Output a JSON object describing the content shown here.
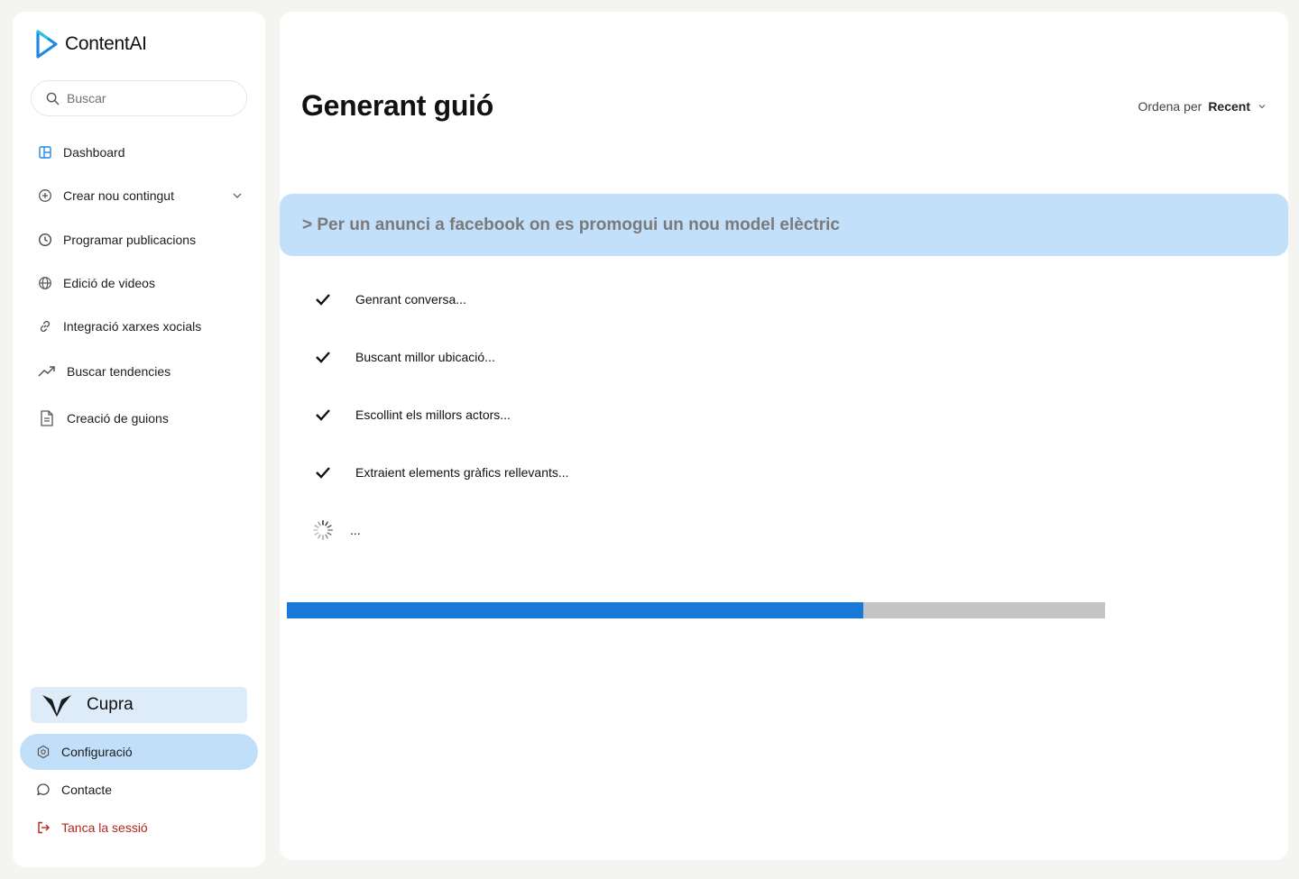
{
  "app": {
    "name": "ContentAI"
  },
  "search": {
    "placeholder": "Buscar"
  },
  "sidebar": {
    "items": [
      {
        "label": "Dashboard",
        "icon": "dashboard-icon"
      },
      {
        "label": "Crear nou contingut",
        "icon": "plus-circle-icon",
        "has_submenu": true
      },
      {
        "label": "Programar publicacions",
        "icon": "clock-icon"
      },
      {
        "label": "Edició de videos",
        "icon": "globe-icon"
      },
      {
        "label": "Integració xarxes xocials",
        "icon": "link-icon"
      },
      {
        "label": "Buscar tendencies",
        "icon": "trending-up-icon"
      },
      {
        "label": "Creació de guions",
        "icon": "document-icon"
      }
    ],
    "brand": {
      "name": "Cupra",
      "icon": "cupra-logo"
    },
    "bottom": {
      "settings": "Configuració",
      "contact": "Contacte",
      "logout": "Tanca la sessió"
    }
  },
  "main": {
    "title": "Generant guió",
    "sort": {
      "prefix": "Ordena per",
      "value": "Recent"
    },
    "prompt": "> Per un anunci a facebook on es promogui un nou model elèctric",
    "steps": [
      {
        "label": "Genrant conversa...",
        "status": "done"
      },
      {
        "label": "Buscant millor ubicació...",
        "status": "done"
      },
      {
        "label": "Escollint els millors actors...",
        "status": "done"
      },
      {
        "label": "Extraient elements gràfics rellevants...",
        "status": "done"
      },
      {
        "label": "...",
        "status": "loading"
      }
    ],
    "progress": 0.705
  },
  "colors": {
    "accent": "#1979d8",
    "prompt_bg": "#c3e0fb",
    "active_nav_bg": "#c2dffa",
    "brand_bg": "#deebf8",
    "logout": "#b3261e",
    "progress_track": "#c4c4c4"
  }
}
